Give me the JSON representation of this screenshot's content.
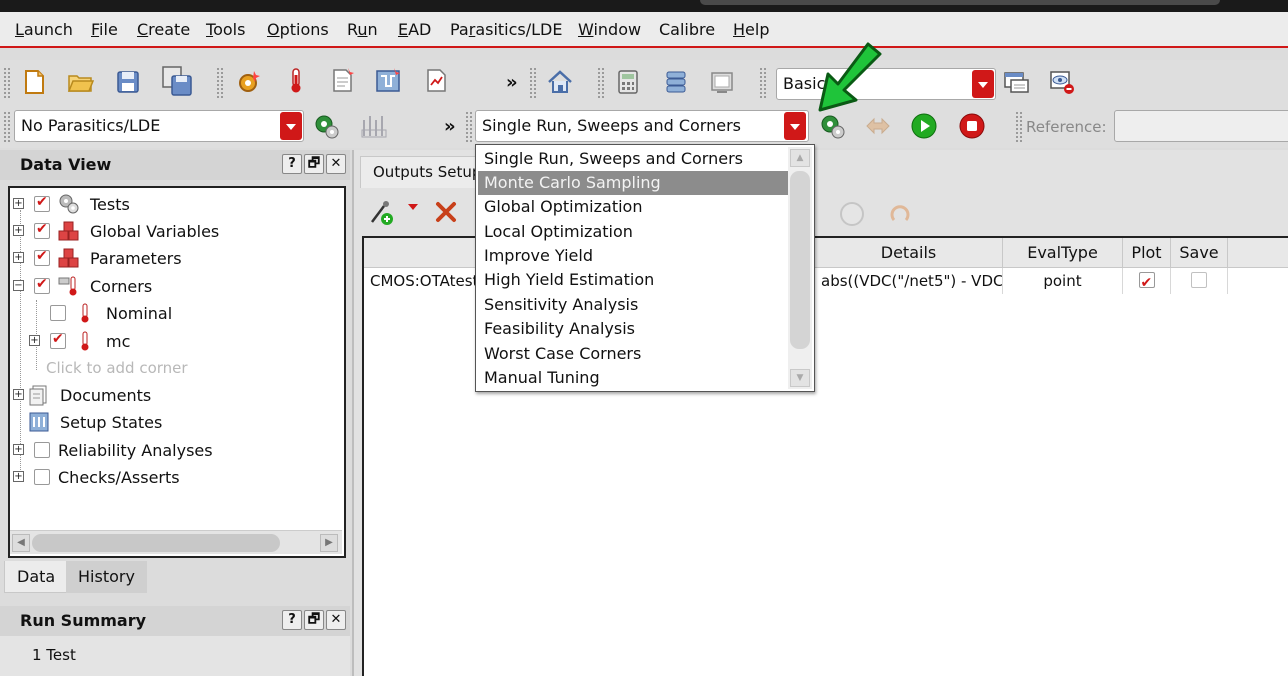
{
  "menubar": {
    "items": [
      {
        "pre": "",
        "u": "L",
        "post": "aunch"
      },
      {
        "pre": "",
        "u": "F",
        "post": "ile"
      },
      {
        "pre": "",
        "u": "C",
        "post": "reate"
      },
      {
        "pre": "",
        "u": "T",
        "post": "ools"
      },
      {
        "pre": "",
        "u": "O",
        "post": "ptions"
      },
      {
        "pre": "R",
        "u": "u",
        "post": "n"
      },
      {
        "pre": "",
        "u": "E",
        "post": "AD"
      },
      {
        "pre": "Pa",
        "u": "r",
        "post": "asitics/LDE"
      },
      {
        "pre": "",
        "u": "W",
        "post": "indow"
      },
      {
        "pre": "Calibre",
        "u": "",
        "post": ""
      },
      {
        "pre": "",
        "u": "H",
        "post": "elp"
      }
    ]
  },
  "toolbar": {
    "basic_combo_value": "Basic",
    "parasitics_combo_value": "No Parasitics/LDE",
    "run_mode_combo_value": "Single Run, Sweeps and Corners",
    "reference_label": "Reference:",
    "chevron": "»"
  },
  "data_view": {
    "title": "Data View",
    "buttons": [
      "?",
      "🗗",
      "✕"
    ],
    "tree": [
      {
        "label": "Tests",
        "checked": true
      },
      {
        "label": "Global Variables",
        "checked": true
      },
      {
        "label": "Parameters",
        "checked": true
      },
      {
        "label": "Corners",
        "checked": true
      },
      {
        "label": "Nominal",
        "checked": false
      },
      {
        "label": "mc",
        "checked": true
      },
      {
        "label": "Click to add corner"
      },
      {
        "label": "Documents"
      },
      {
        "label": "Setup States"
      },
      {
        "label": "Reliability Analyses",
        "checked": false
      },
      {
        "label": "Checks/Asserts",
        "checked": false
      }
    ],
    "tabs": [
      "Data",
      "History"
    ]
  },
  "run_summary": {
    "title": "Run Summary",
    "text": "1 Test"
  },
  "outputs": {
    "tab_label": "Outputs Setup",
    "columns": [
      "Details",
      "EvalType",
      "Plot",
      "Save"
    ],
    "rows": [
      {
        "test": "CMOS:OTAtest",
        "details": "abs((VDC(\"/net5\") - VDC...",
        "evaltype": "point",
        "plot": true,
        "save": false
      }
    ]
  },
  "run_mode_dropdown": {
    "selected_index": 1,
    "options": [
      "Single Run, Sweeps and Corners",
      "Monte Carlo Sampling",
      "Global Optimization",
      "Local Optimization",
      "Improve Yield",
      "High Yield Estimation",
      "Sensitivity Analysis",
      "Feasibility Analysis",
      "Worst Case Corners",
      "Manual Tuning"
    ]
  },
  "colors": {
    "accent_red": "#d01818",
    "highlight_gray": "#8c8c8c",
    "annotation_green": "#1fc43a",
    "run_green": "#22aa22"
  }
}
